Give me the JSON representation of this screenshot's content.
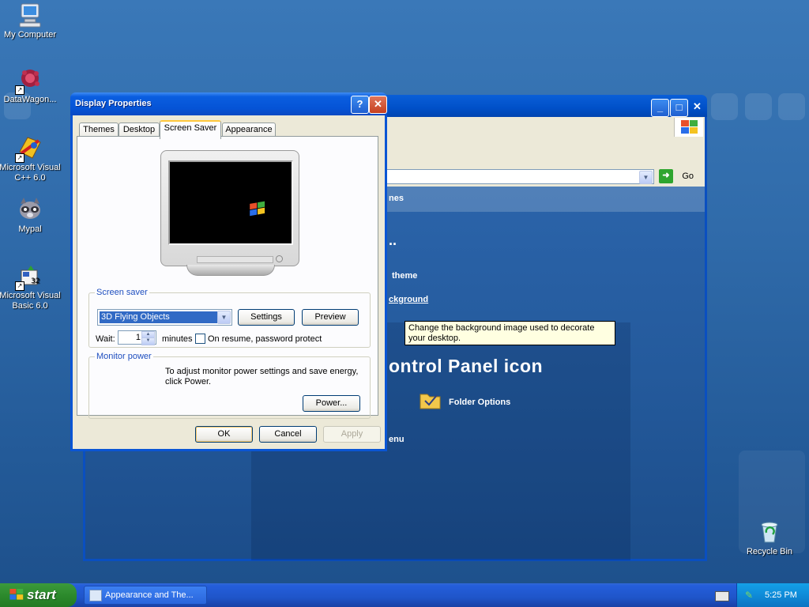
{
  "desktop": {
    "icons": [
      {
        "label": "My Computer"
      },
      {
        "label": "DataWagon..."
      },
      {
        "label": "Microsoft Visual C++ 6.0"
      },
      {
        "label": "Mypal"
      },
      {
        "label": "Microsoft Visual Basic 6.0"
      },
      {
        "label": "Recycle Bin"
      }
    ]
  },
  "background_window": {
    "title": "Appearance and The...",
    "go_label": "Go",
    "visible_fragments": {
      "themes_link": "nes",
      "dots": "..",
      "change_theme": "theme",
      "change_background": "ckground",
      "control_panel_heading": "ontrol Panel icon",
      "folder_options": "Folder Options",
      "menu_fragment": "enu"
    }
  },
  "tooltip": {
    "text": "Change the background image used to decorate your desktop."
  },
  "dialog": {
    "title": "Display Properties",
    "help_btn": "?",
    "close_btn": "✕",
    "tabs": [
      {
        "label": "Themes",
        "active": false
      },
      {
        "label": "Desktop",
        "active": false
      },
      {
        "label": "Screen Saver",
        "active": true
      },
      {
        "label": "Appearance",
        "active": false
      }
    ],
    "screen_saver": {
      "legend": "Screen saver",
      "selected": "3D Flying Objects",
      "settings_label": "Settings",
      "preview_label": "Preview",
      "wait_label": "Wait:",
      "wait_value": "1",
      "minutes_label": "minutes",
      "password_label": "On resume, password protect",
      "password_checked": false
    },
    "monitor_power": {
      "legend": "Monitor power",
      "text": "To adjust monitor power settings and save energy, click Power.",
      "power_label": "Power..."
    },
    "buttons": {
      "ok": "OK",
      "cancel": "Cancel",
      "apply": "Apply"
    }
  },
  "taskbar": {
    "start_label": "start",
    "task_label": "Appearance and The...",
    "clock": "5:25 PM"
  },
  "colors": {
    "xp_blue": "#0a5ee0",
    "dialog_bg": "#ece9d8",
    "tooltip_bg": "#ffffe1",
    "start_green": "#2c8a2c"
  }
}
